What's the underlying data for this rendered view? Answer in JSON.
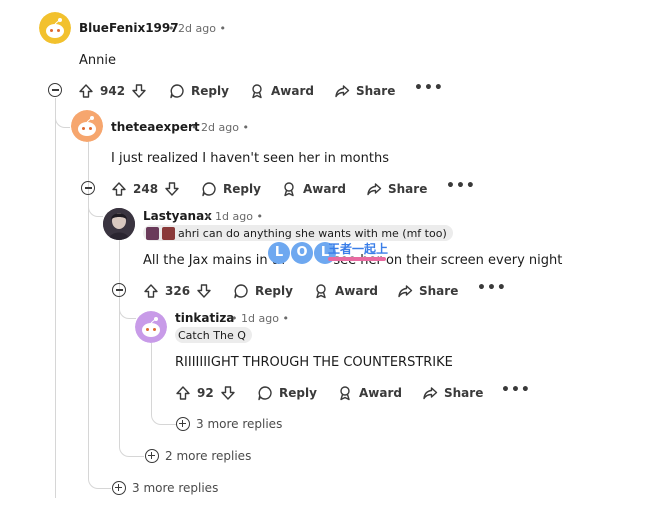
{
  "comments": [
    {
      "username": "BlueFenix1997",
      "age": "2d ago",
      "body": "Annie",
      "score": "942",
      "avatar_color": "#f2c12e"
    },
    {
      "username": "theteaexpert",
      "age": "2d ago",
      "body": "I just realized I haven't seen her in months",
      "score": "248",
      "avatar_color": "#f6a66e"
    },
    {
      "username": "Lastyanax",
      "age": "1d ago",
      "flair": "ahri can do anything she wants with me (mf too)",
      "body_start": "All the Jax mains in th",
      "body_end": "see her on their screen every night",
      "score": "326",
      "avatar_color": "#3a3440"
    },
    {
      "username": "tinkatiza",
      "age": "1d ago",
      "flair": "Catch The Q",
      "body": "RIIIIIIIGHT THROUGH THE COUNTERSTRIKE",
      "score": "92",
      "avatar_color": "#c89be8"
    }
  ],
  "actions": {
    "reply": "Reply",
    "award": "Award",
    "share": "Share",
    "overflow": "•••"
  },
  "separator": "•",
  "more_replies": {
    "level3": "3 more replies",
    "level2": "2 more replies",
    "level1": "3 more replies"
  },
  "watermark": {
    "lol": "LOL",
    "cn_text": "王者一起上"
  }
}
